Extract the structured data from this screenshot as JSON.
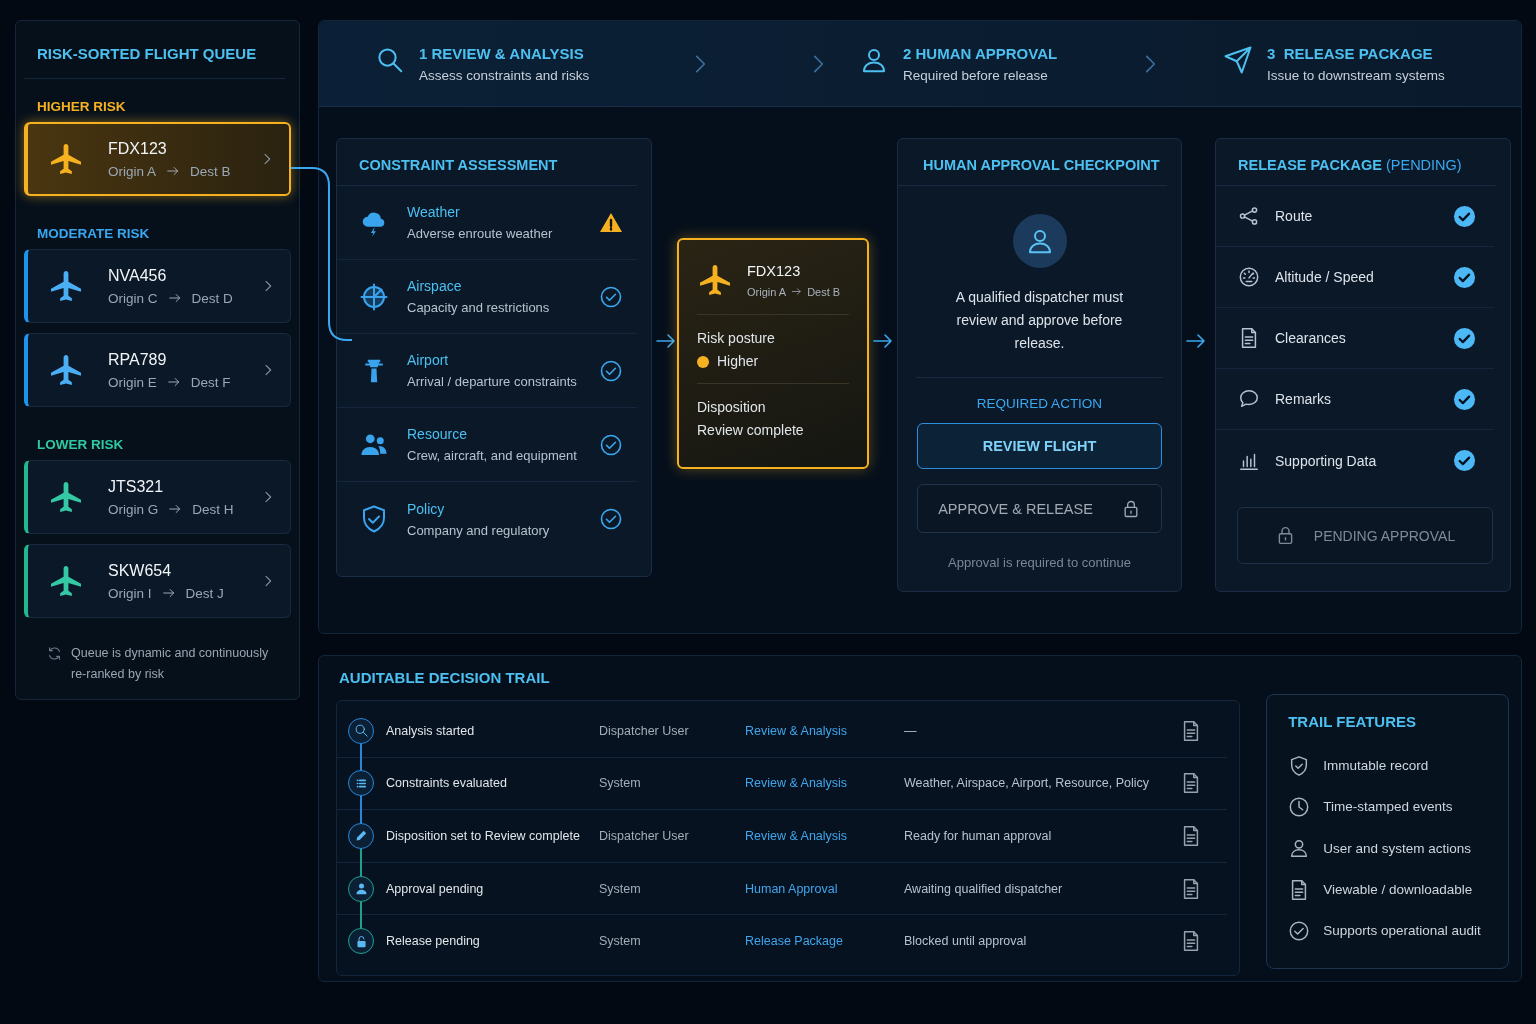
{
  "queue": {
    "title": "RISK-SORTED FLIGHT QUEUE",
    "groups": [
      {
        "label": "HIGHER RISK",
        "kind": "higher",
        "flights": [
          {
            "code": "FDX123",
            "origin": "Origin A",
            "dest": "Dest B",
            "selected": true
          }
        ]
      },
      {
        "label": "MODERATE RISK",
        "kind": "moderate",
        "flights": [
          {
            "code": "NVA456",
            "origin": "Origin C",
            "dest": "Dest D",
            "selected": false
          },
          {
            "code": "RPA789",
            "origin": "Origin E",
            "dest": "Dest F",
            "selected": false
          }
        ]
      },
      {
        "label": "LOWER RISK",
        "kind": "lower",
        "flights": [
          {
            "code": "JTS321",
            "origin": "Origin G",
            "dest": "Dest H",
            "selected": false
          },
          {
            "code": "SKW654",
            "origin": "Origin I",
            "dest": "Dest J",
            "selected": false
          }
        ]
      }
    ],
    "note": "Queue is dynamic and continuously re-ranked by risk"
  },
  "steps": [
    {
      "kind": "search",
      "title": "1 REVIEW & ANALYSIS",
      "subtitle": "Assess constraints and risks"
    },
    {
      "kind": "user",
      "title": "2 HUMAN APPROVAL",
      "subtitle": "Required before release"
    },
    {
      "kind": "send",
      "title": "3  RELEASE PACKAGE",
      "subtitle": "Issue to downstream systems"
    }
  ],
  "constraints": {
    "title": "CONSTRAINT ASSESSMENT",
    "items": [
      {
        "kind": "weather",
        "title": "Weather",
        "detail": "Adverse enroute weather",
        "flagged": true
      },
      {
        "kind": "airspace",
        "title": "Airspace",
        "detail": "Capacity and restrictions",
        "flagged": false
      },
      {
        "kind": "airport",
        "title": "Airport",
        "detail": "Arrival / departure constraints",
        "flagged": false
      },
      {
        "kind": "resource",
        "title": "Resource",
        "detail": "Crew, aircraft, and equipment",
        "flagged": false
      },
      {
        "kind": "policy",
        "title": "Policy",
        "detail": "Company and regulatory",
        "flagged": false
      }
    ]
  },
  "focus_flight": {
    "code": "FDX123",
    "origin": "Origin A",
    "dest": "Dest B",
    "risk_label": "Risk posture",
    "risk": {
      "label": "Higher",
      "color": "#f5b120"
    },
    "disposition_label": "Disposition",
    "disposition_value": "Review complete"
  },
  "approval": {
    "title": "HUMAN APPROVAL CHECKPOINT",
    "message": "A qualified dispatcher must review and approve before release.",
    "action_label": "REQUIRED ACTION",
    "buttons": [
      {
        "label": "REVIEW FLIGHT",
        "kind": "primary",
        "disabled": false,
        "locked": false
      },
      {
        "label": "APPROVE & RELEASE",
        "kind": "secondary",
        "disabled": true,
        "locked": true
      }
    ],
    "note": "Approval is required to continue"
  },
  "release": {
    "title": "RELEASE PACKAGE",
    "status": "(PENDING)",
    "items": [
      {
        "kind": "route",
        "label": "Route",
        "checked": true
      },
      {
        "kind": "gauge",
        "label": "Altitude / Speed",
        "checked": true
      },
      {
        "kind": "doc",
        "label": "Clearances",
        "checked": true
      },
      {
        "kind": "chat",
        "label": "Remarks",
        "checked": true
      },
      {
        "kind": "bars",
        "label": "Supporting Data",
        "checked": true
      }
    ],
    "button": {
      "label": "PENDING APPROVAL",
      "disabled": true,
      "locked": true
    }
  },
  "trail": {
    "title": "AUDITABLE DECISION TRAIL",
    "rows": [
      {
        "kind": "search",
        "event": "Analysis started",
        "actor": "Dispatcher User",
        "stage": "Review & Analysis",
        "detail": "—",
        "color": "#2a86d8"
      },
      {
        "kind": "list",
        "event": "Constraints evaluated",
        "actor": "System",
        "stage": "Review & Analysis",
        "detail": "Weather, Airspace, Airport, Resource, Policy",
        "color": "#2a86d8"
      },
      {
        "kind": "pencil",
        "event": "Disposition set to Review complete",
        "actor": "Dispatcher User",
        "stage": "Review & Analysis",
        "detail": "Ready for human approval",
        "color": "#2a86d8"
      },
      {
        "kind": "userfill",
        "event": "Approval pending",
        "actor": "System",
        "stage": "Human Approval",
        "detail": "Awaiting qualified dispatcher",
        "color": "#1fa08e"
      },
      {
        "kind": "lockfill",
        "event": "Release pending",
        "actor": "System",
        "stage": "Release Package",
        "detail": "Blocked until approval",
        "color": "#1fa08e"
      }
    ]
  },
  "features": {
    "title": "TRAIL FEATURES",
    "items": [
      {
        "kind": "shield",
        "label": "Immutable record"
      },
      {
        "kind": "clock",
        "label": "Time-stamped events"
      },
      {
        "kind": "user",
        "label": "User and system actions"
      },
      {
        "kind": "doc",
        "label": "Viewable / downloadable"
      },
      {
        "kind": "checkcircle",
        "label": "Supports operational audit"
      }
    ]
  }
}
